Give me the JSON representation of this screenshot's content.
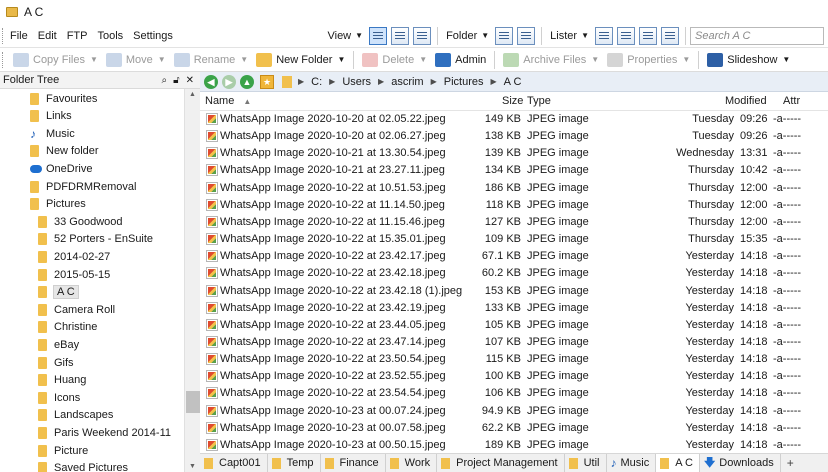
{
  "window": {
    "title": "A C"
  },
  "menu": [
    "File",
    "Edit",
    "FTP",
    "Tools",
    "Settings"
  ],
  "menubar_right": {
    "view": "View",
    "folder": "Folder",
    "lister": "Lister",
    "search_placeholder": "Search A C"
  },
  "toolbar": [
    {
      "label": "Copy Files",
      "enabled": false,
      "icon": "copy-files-icon"
    },
    {
      "label": "Move",
      "enabled": false,
      "icon": "move-icon"
    },
    {
      "label": "Rename",
      "enabled": false,
      "icon": "rename-icon"
    },
    {
      "label": "New Folder",
      "enabled": true,
      "icon": "new-folder-icon"
    },
    {
      "label": "Delete",
      "enabled": false,
      "icon": "delete-icon"
    },
    {
      "label": "Admin",
      "enabled": true,
      "icon": "admin-icon"
    },
    {
      "label": "Archive Files",
      "enabled": false,
      "icon": "archive-icon"
    },
    {
      "label": "Properties",
      "enabled": false,
      "icon": "properties-icon"
    },
    {
      "label": "Slideshow",
      "enabled": true,
      "icon": "slideshow-icon"
    }
  ],
  "tree": {
    "header": "Folder Tree",
    "items": [
      {
        "label": "Favourites",
        "indent": 0,
        "icon": "folder"
      },
      {
        "label": "Links",
        "indent": 0,
        "icon": "folder"
      },
      {
        "label": "Music",
        "indent": 0,
        "icon": "music"
      },
      {
        "label": "New folder",
        "indent": 0,
        "icon": "folder"
      },
      {
        "label": "OneDrive",
        "indent": 0,
        "icon": "cloud"
      },
      {
        "label": "PDFDRMRemoval",
        "indent": 0,
        "icon": "folder"
      },
      {
        "label": "Pictures",
        "indent": 0,
        "icon": "folder"
      },
      {
        "label": "33 Goodwood",
        "indent": 1,
        "icon": "folder"
      },
      {
        "label": "52 Porters - EnSuite",
        "indent": 1,
        "icon": "folder"
      },
      {
        "label": "2014-02-27",
        "indent": 1,
        "icon": "folder"
      },
      {
        "label": "2015-05-15",
        "indent": 1,
        "icon": "folder"
      },
      {
        "label": "A C",
        "indent": 1,
        "icon": "folder",
        "selected": true
      },
      {
        "label": "Camera Roll",
        "indent": 1,
        "icon": "folder"
      },
      {
        "label": "Christine",
        "indent": 1,
        "icon": "folder"
      },
      {
        "label": "eBay",
        "indent": 1,
        "icon": "folder"
      },
      {
        "label": "Gifs",
        "indent": 1,
        "icon": "folder"
      },
      {
        "label": "Huang",
        "indent": 1,
        "icon": "folder"
      },
      {
        "label": "Icons",
        "indent": 1,
        "icon": "folder"
      },
      {
        "label": "Landscapes",
        "indent": 1,
        "icon": "folder"
      },
      {
        "label": "Paris Weekend 2014-11",
        "indent": 1,
        "icon": "folder"
      },
      {
        "label": "Picture",
        "indent": 1,
        "icon": "folder"
      },
      {
        "label": "Saved Pictures",
        "indent": 1,
        "icon": "folder"
      }
    ]
  },
  "path": [
    "C:",
    "Users",
    "ascrim",
    "Pictures",
    "A C"
  ],
  "columns": {
    "name": "Name",
    "size": "Size",
    "type": "Type",
    "modified": "Modified",
    "attr": "Attr"
  },
  "files": [
    {
      "name": "WhatsApp Image 2020-10-20 at 02.05.22.jpeg",
      "size": "149 KB",
      "type": "JPEG image",
      "day": "Tuesday",
      "time": "09:26",
      "attr": "-a-----"
    },
    {
      "name": "WhatsApp Image 2020-10-20 at 02.06.27.jpeg",
      "size": "138 KB",
      "type": "JPEG image",
      "day": "Tuesday",
      "time": "09:26",
      "attr": "-a-----"
    },
    {
      "name": "WhatsApp Image 2020-10-21 at 13.30.54.jpeg",
      "size": "139 KB",
      "type": "JPEG image",
      "day": "Wednesday",
      "time": "13:31",
      "attr": "-a-----"
    },
    {
      "name": "WhatsApp Image 2020-10-21 at 23.27.11.jpeg",
      "size": "134 KB",
      "type": "JPEG image",
      "day": "Thursday",
      "time": "10:42",
      "attr": "-a-----"
    },
    {
      "name": "WhatsApp Image 2020-10-22 at 10.51.53.jpeg",
      "size": "186 KB",
      "type": "JPEG image",
      "day": "Thursday",
      "time": "12:00",
      "attr": "-a-----"
    },
    {
      "name": "WhatsApp Image 2020-10-22 at 11.14.50.jpeg",
      "size": "118 KB",
      "type": "JPEG image",
      "day": "Thursday",
      "time": "12:00",
      "attr": "-a-----"
    },
    {
      "name": "WhatsApp Image 2020-10-22 at 11.15.46.jpeg",
      "size": "127 KB",
      "type": "JPEG image",
      "day": "Thursday",
      "time": "12:00",
      "attr": "-a-----"
    },
    {
      "name": "WhatsApp Image 2020-10-22 at 15.35.01.jpeg",
      "size": "109 KB",
      "type": "JPEG image",
      "day": "Thursday",
      "time": "15:35",
      "attr": "-a-----"
    },
    {
      "name": "WhatsApp Image 2020-10-22 at 23.42.17.jpeg",
      "size": "67.1 KB",
      "type": "JPEG image",
      "day": "Yesterday",
      "time": "14:18",
      "attr": "-a-----"
    },
    {
      "name": "WhatsApp Image 2020-10-22 at 23.42.18.jpeg",
      "size": "60.2 KB",
      "type": "JPEG image",
      "day": "Yesterday",
      "time": "14:18",
      "attr": "-a-----"
    },
    {
      "name": "WhatsApp Image 2020-10-22 at 23.42.18 (1).jpeg",
      "size": "153 KB",
      "type": "JPEG image",
      "day": "Yesterday",
      "time": "14:18",
      "attr": "-a-----"
    },
    {
      "name": "WhatsApp Image 2020-10-22 at 23.42.19.jpeg",
      "size": "133 KB",
      "type": "JPEG image",
      "day": "Yesterday",
      "time": "14:18",
      "attr": "-a-----"
    },
    {
      "name": "WhatsApp Image 2020-10-22 at 23.44.05.jpeg",
      "size": "105 KB",
      "type": "JPEG image",
      "day": "Yesterday",
      "time": "14:18",
      "attr": "-a-----"
    },
    {
      "name": "WhatsApp Image 2020-10-22 at 23.47.14.jpeg",
      "size": "107 KB",
      "type": "JPEG image",
      "day": "Yesterday",
      "time": "14:18",
      "attr": "-a-----"
    },
    {
      "name": "WhatsApp Image 2020-10-22 at 23.50.54.jpeg",
      "size": "115 KB",
      "type": "JPEG image",
      "day": "Yesterday",
      "time": "14:18",
      "attr": "-a-----"
    },
    {
      "name": "WhatsApp Image 2020-10-22 at 23.52.55.jpeg",
      "size": "100 KB",
      "type": "JPEG image",
      "day": "Yesterday",
      "time": "14:18",
      "attr": "-a-----"
    },
    {
      "name": "WhatsApp Image 2020-10-22 at 23.54.54.jpeg",
      "size": "106 KB",
      "type": "JPEG image",
      "day": "Yesterday",
      "time": "14:18",
      "attr": "-a-----"
    },
    {
      "name": "WhatsApp Image 2020-10-23 at 00.07.24.jpeg",
      "size": "94.9 KB",
      "type": "JPEG image",
      "day": "Yesterday",
      "time": "14:18",
      "attr": "-a-----"
    },
    {
      "name": "WhatsApp Image 2020-10-23 at 00.07.58.jpeg",
      "size": "62.2 KB",
      "type": "JPEG image",
      "day": "Yesterday",
      "time": "14:18",
      "attr": "-a-----"
    },
    {
      "name": "WhatsApp Image 2020-10-23 at 00.50.15.jpeg",
      "size": "189 KB",
      "type": "JPEG image",
      "day": "Yesterday",
      "time": "14:18",
      "attr": "-a-----"
    }
  ],
  "tabs": [
    {
      "label": "Capt001",
      "icon": "folder"
    },
    {
      "label": "Temp",
      "icon": "folder"
    },
    {
      "label": "Finance",
      "icon": "folder"
    },
    {
      "label": "Work",
      "icon": "folder"
    },
    {
      "label": "Project Management",
      "icon": "folder"
    },
    {
      "label": "Util",
      "icon": "folder"
    },
    {
      "label": "Music",
      "icon": "music"
    },
    {
      "label": "A C",
      "icon": "folder",
      "active": true
    },
    {
      "label": "Downloads",
      "icon": "download"
    }
  ],
  "tab_add": "+",
  "colors": {
    "folder": "#f1c04d",
    "accent": "#3a78c3",
    "nav_green": "#3aa34a"
  }
}
